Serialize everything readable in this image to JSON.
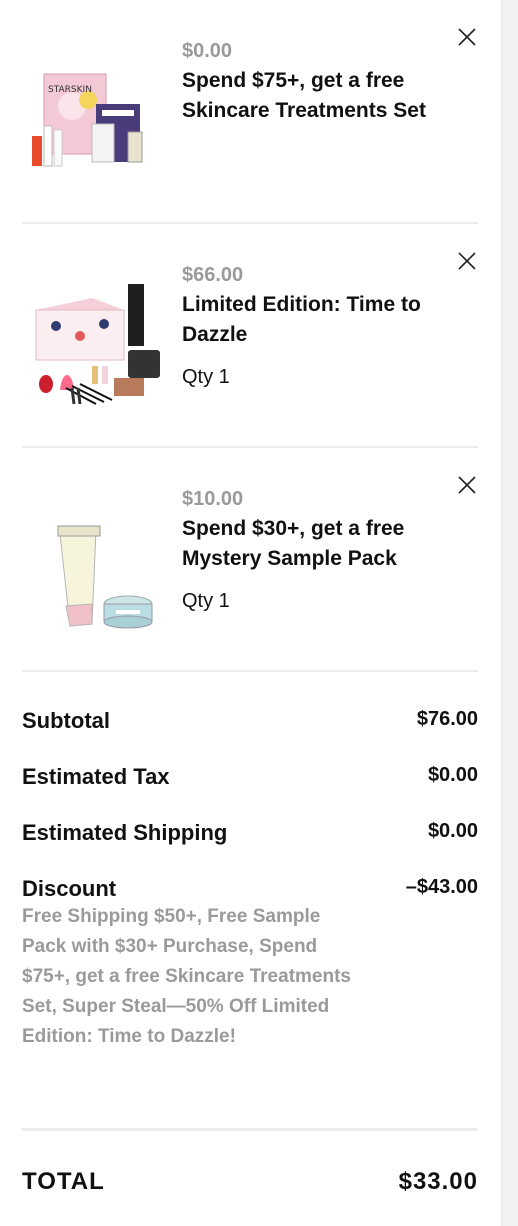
{
  "items": [
    {
      "price": "$0.00",
      "name": "Spend $75+, get a free Skincare Treatments Set",
      "qty": "",
      "image": "skincare-set-image"
    },
    {
      "price": "$66.00",
      "name": "Limited Edition: Time to Dazzle",
      "qty": "Qty 1",
      "image": "dazzle-kit-image"
    },
    {
      "price": "$10.00",
      "name": "Spend $30+, get a free Mystery Sample Pack",
      "qty": "Qty 1",
      "image": "sample-pack-image"
    }
  ],
  "summary": {
    "subtotal_label": "Subtotal",
    "subtotal_value": "$76.00",
    "tax_label": "Estimated Tax",
    "tax_value": "$0.00",
    "shipping_label": "Estimated Shipping",
    "shipping_value": "$0.00",
    "discount_label": "Discount",
    "discount_value": "–$43.00",
    "discount_description": "Free Shipping $50+, Free Sample Pack with $30+ Purchase, Spend $75+, get a free Skincare Treatments Set, Super Steal—50% Off Limited Edition: Time to Dazzle!",
    "total_label": "TOTAL",
    "total_value": "$33.00"
  },
  "icons": {
    "remove": "close-icon"
  }
}
